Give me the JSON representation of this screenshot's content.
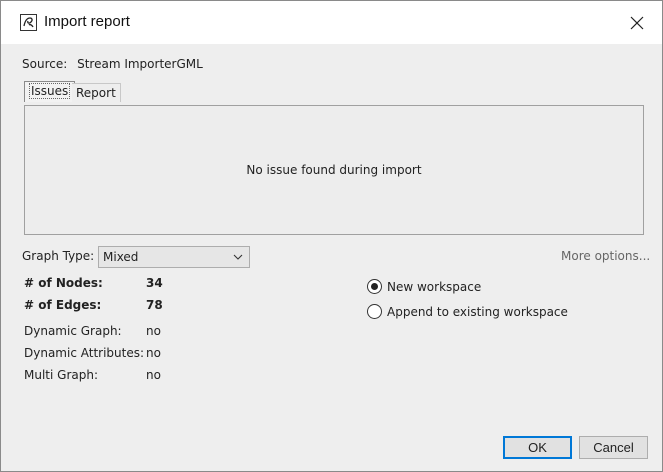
{
  "window": {
    "title": "Import report",
    "icon": "gephi-app-icon",
    "close_icon": "close-icon"
  },
  "source": {
    "label": "Source:",
    "value": "Stream ImporterGML"
  },
  "tabs": [
    {
      "label": "Issues",
      "active": true
    },
    {
      "label": "Report",
      "active": false
    }
  ],
  "issues": {
    "message": "No issue found during import"
  },
  "graph_type": {
    "label": "Graph Type:",
    "selected": "Mixed",
    "more_options": "More options..."
  },
  "stats": {
    "nodes_label": "# of Nodes:",
    "nodes_value": "34",
    "edges_label": "# of Edges:",
    "edges_value": "78",
    "dynamic_graph_label": "Dynamic Graph:",
    "dynamic_graph_value": "no",
    "dynamic_attributes_label": "Dynamic Attributes:",
    "dynamic_attributes_value": "no",
    "multi_graph_label": "Multi Graph:",
    "multi_graph_value": "no"
  },
  "workspace": {
    "new_label": "New workspace",
    "new_checked": true,
    "append_label": "Append to existing workspace",
    "append_checked": false
  },
  "buttons": {
    "ok": "OK",
    "cancel": "Cancel"
  },
  "colors": {
    "accent": "#0078d7",
    "background": "#eeeeee",
    "titlebar": "#ffffff"
  }
}
